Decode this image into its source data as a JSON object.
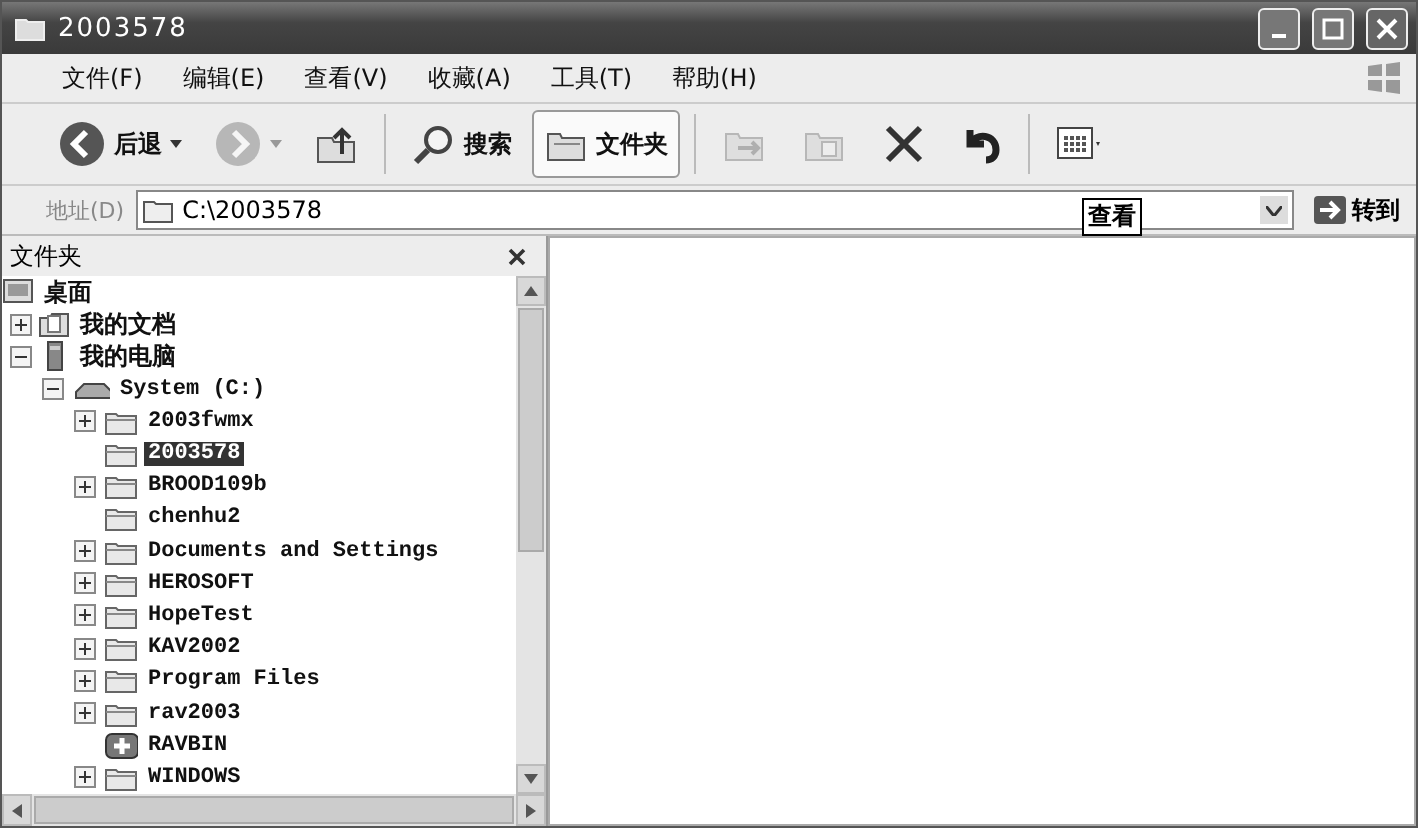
{
  "window": {
    "title": "2003578"
  },
  "menu": [
    {
      "label": "文件(F)"
    },
    {
      "label": "编辑(E)"
    },
    {
      "label": "查看(V)"
    },
    {
      "label": "收藏(A)"
    },
    {
      "label": "工具(T)"
    },
    {
      "label": "帮助(H)"
    }
  ],
  "toolbar": [
    {
      "kind": "back",
      "label": "后退",
      "disabled": false
    },
    {
      "kind": "forward",
      "disabled": true
    },
    {
      "kind": "up",
      "disabled": false
    },
    {
      "kind": "search",
      "label": "搜索",
      "selected": false
    },
    {
      "kind": "folders",
      "label": "文件夹",
      "selected": true
    },
    {
      "kind": "move",
      "disabled": true
    },
    {
      "kind": "copy",
      "disabled": true
    },
    {
      "kind": "delete",
      "disabled": false
    },
    {
      "kind": "undo",
      "disabled": false
    },
    {
      "kind": "views",
      "disabled": false
    }
  ],
  "address": {
    "label": "地址(D)",
    "value": "C:\\2003578",
    "go": "转到",
    "tooltip": "查看"
  },
  "folder_pane": {
    "title": "文件夹",
    "tree": [
      {
        "label": "桌面",
        "kind": "desktop",
        "selected": false,
        "children": [
          {
            "label": "我的文档",
            "kind": "documents",
            "expanded": false,
            "selected": false
          },
          {
            "label": "我的电脑",
            "kind": "computer",
            "expanded": true,
            "selected": false,
            "children": [
              {
                "label": "System (C:)",
                "kind": "drive",
                "expanded": true,
                "selected": false,
                "children": [
                  {
                    "label": "2003fwmx",
                    "kind": "folder",
                    "expanded": false,
                    "selected": false
                  },
                  {
                    "label": "2003578",
                    "kind": "folder",
                    "selected": true
                  },
                  {
                    "label": "BROOD109b",
                    "kind": "folder",
                    "expanded": false,
                    "selected": false
                  },
                  {
                    "label": "chenhu2",
                    "kind": "folder",
                    "selected": false
                  },
                  {
                    "label": "Documents and Settings",
                    "kind": "folder",
                    "expanded": false,
                    "selected": false
                  },
                  {
                    "label": "HEROSOFT",
                    "kind": "folder",
                    "expanded": false,
                    "selected": false
                  },
                  {
                    "label": "HopeTest",
                    "kind": "folder",
                    "expanded": false,
                    "selected": false
                  },
                  {
                    "label": "KAV2002",
                    "kind": "folder",
                    "expanded": false,
                    "selected": false
                  },
                  {
                    "label": "Program Files",
                    "kind": "folder",
                    "expanded": false,
                    "selected": false
                  },
                  {
                    "label": "rav2003",
                    "kind": "folder",
                    "expanded": false,
                    "selected": false
                  },
                  {
                    "label": "RAVBIN",
                    "kind": "special",
                    "selected": false
                  },
                  {
                    "label": "WINDOWS",
                    "kind": "folder",
                    "expanded": false,
                    "selected": false
                  }
                ]
              }
            ]
          }
        ]
      }
    ]
  }
}
